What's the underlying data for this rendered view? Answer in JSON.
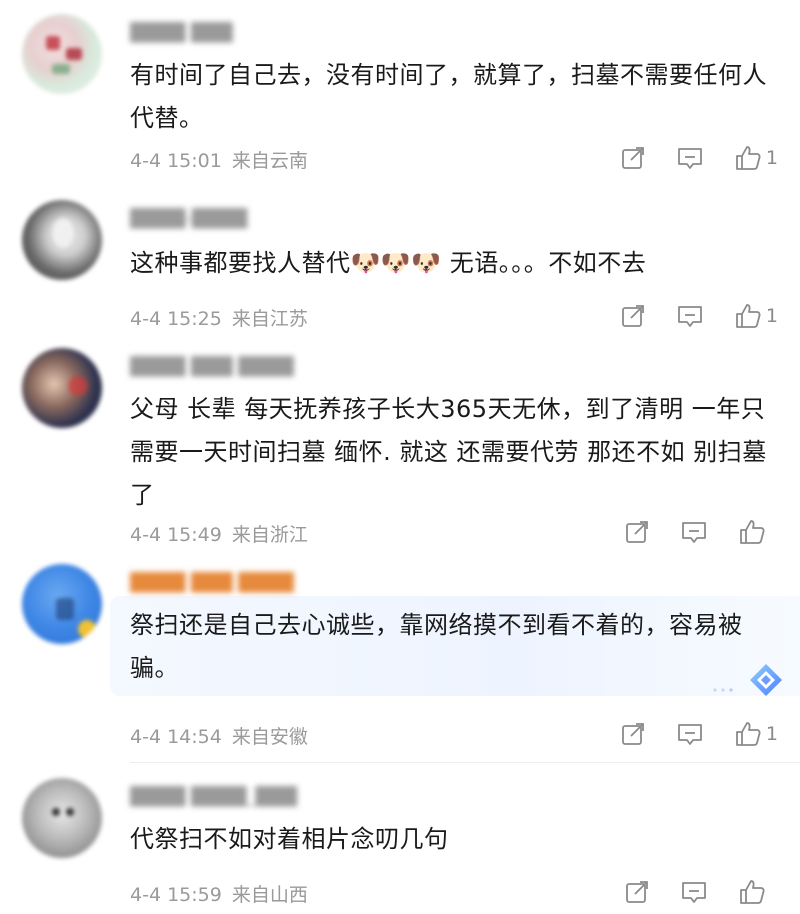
{
  "comments": [
    {
      "username": "████ ███",
      "text": "有时间了自己去，没有时间了，就算了，扫墓不需要任何人代替。",
      "date": "4-4 15:01",
      "location": "来自云南",
      "likes": "1"
    },
    {
      "username": "████-████",
      "text": "这种事都要找人替代🐶🐶🐶 无语。。。不如不去",
      "date": "4-4 15:25",
      "location": "来自江苏",
      "likes": "1"
    },
    {
      "username": "████ ███ ████",
      "text": "父母 长辈 每天抚养孩子长大365天无休，到了清明 一年只需要一天时间扫墓 缅怀. 就这 还需要代劳 那还不如 别扫墓了",
      "date": "4-4 15:49",
      "location": "来自浙江",
      "likes": ""
    },
    {
      "username": "████ ███ ████",
      "text": "祭扫还是自己去心诚些，靠网络摸不到看不着的，容易被骗。",
      "date": "4-4 14:54",
      "location": "来自安徽",
      "likes": "1"
    },
    {
      "username": "████ ████_███",
      "text": "代祭扫不如对着相片念叨几句",
      "date": "4-4 15:59",
      "location": "来自山西",
      "likes": ""
    }
  ],
  "icons": {
    "share": "share-icon",
    "comment": "comment-icon",
    "like": "thumbs-up-icon",
    "ai": "ai-sparkle-icon"
  },
  "colors": {
    "text": "#1a1a1a",
    "meta": "#9a9a9a",
    "highlight": "#eef4ff",
    "ai_badge": "#5a8cff"
  }
}
